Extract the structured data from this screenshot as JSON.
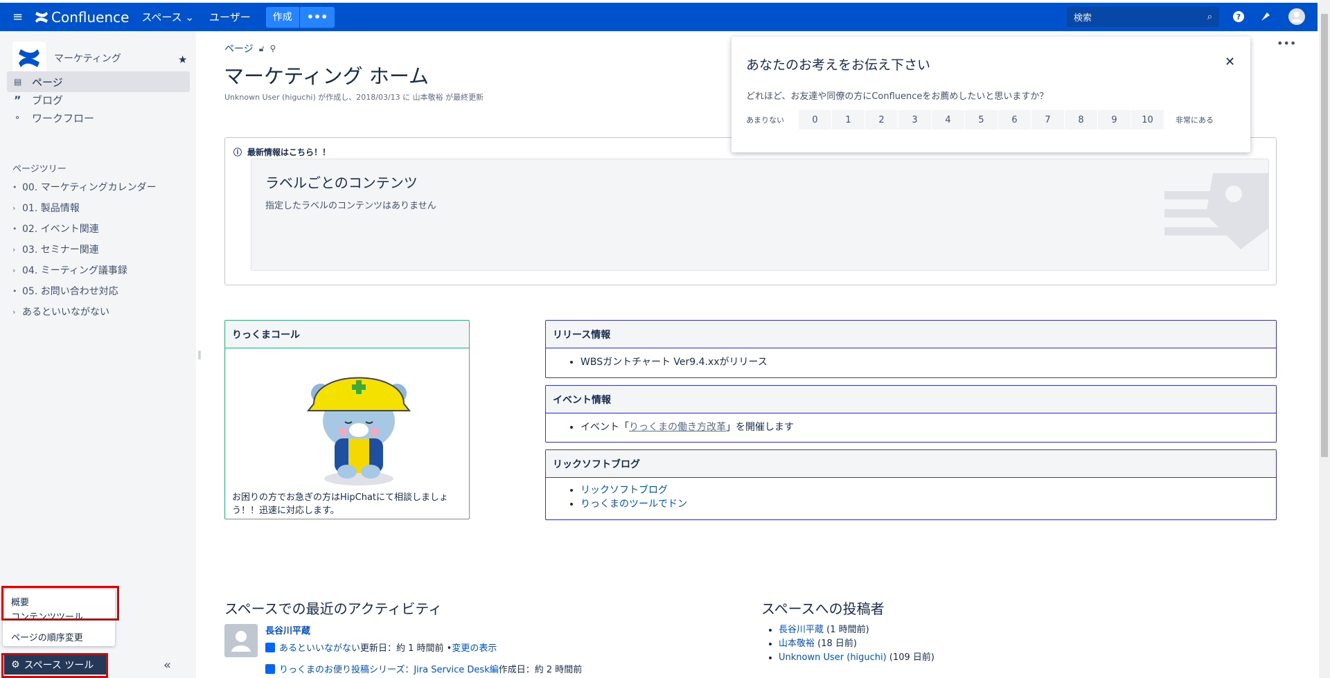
{
  "topbar": {
    "app_name": "Confluence",
    "nav_spaces": "スペース",
    "nav_users": "ユーザー",
    "create_label": "作成",
    "search_placeholder": "検索"
  },
  "sidebar": {
    "space_name": "マーケティング",
    "menu": [
      {
        "label": "ページ",
        "icon": "page-icon",
        "active": true
      },
      {
        "label": "ブログ",
        "icon": "quote-icon",
        "active": false
      },
      {
        "label": "ワークフロー",
        "icon": "workflow-icon",
        "active": false
      }
    ],
    "tree_heading": "ページツリー",
    "tree": [
      {
        "label": "00. マーケティングカレンダー",
        "bullet": "•"
      },
      {
        "label": "01. 製品情報",
        "bullet": "›"
      },
      {
        "label": "02. イベント関連",
        "bullet": "•"
      },
      {
        "label": "03. セミナー関連",
        "bullet": "›"
      },
      {
        "label": "04. ミーティング議事録",
        "bullet": "›"
      },
      {
        "label": "05. お問い合わせ対応",
        "bullet": "•"
      },
      {
        "label": "あるといいながない",
        "bullet": "›"
      }
    ],
    "popup_items": [
      "概要",
      "コンテンツツール",
      "ページの順序変更"
    ],
    "space_tools": "スペース ツール"
  },
  "page": {
    "breadcrumb": "ページ",
    "title": "マーケティング ホーム",
    "meta": "Unknown User (higuchi) が作成し、2018/03/13 に 山本敬裕 が最終更新",
    "info_panel": {
      "heading": "最新情報はこちら！！",
      "inner_title": "ラベルごとのコンテンツ",
      "inner_text": "指定したラベルのコンテンツはありません"
    },
    "rikkuma": {
      "heading": "りっくまコール",
      "text": "お困りの方でお急ぎの方はHipChatにて相談しましょう！！迅速に対応します。"
    },
    "release": {
      "heading": "リリース情報",
      "item": "WBSガントチャート Ver9.4.xxがリリース"
    },
    "event": {
      "heading": "イベント情報",
      "prefix": "イベント「",
      "link": "りっくまの働き方改革",
      "suffix": "」を開催します"
    },
    "blog": {
      "heading": "リックソフトブログ",
      "items": [
        "リックソフトブログ",
        "りっくまのツールでドン"
      ]
    },
    "activity": {
      "heading": "スペースでの最近のアクティビティ",
      "user": "長谷川平蔵",
      "row1_link": "あるといいながない",
      "row1_meta": " 更新日：約 1 時間前 • ",
      "row1_change": "変更の表示",
      "row2_link": "りっくまのお便り投稿シリーズ：Jira Service Desk編",
      "row2_meta": " 作成日：約 2 時間前"
    },
    "contributors": {
      "heading": "スペースへの投稿者",
      "items": [
        {
          "name": "長谷川平蔵",
          "when": " (1 時間前)"
        },
        {
          "name": "山本敬裕",
          "when": " (18 日前)"
        },
        {
          "name": "Unknown User (higuchi)",
          "when": " (109 日前)"
        }
      ]
    }
  },
  "survey": {
    "heading": "あなたのお考えをお伝え下さい",
    "question": "どれほど、お友達や同僚の方にConfluenceをお薦めしたいと思いますか？",
    "low_label": "あまりない",
    "high_label": "非常にある",
    "scale": [
      "0",
      "1",
      "2",
      "3",
      "4",
      "5",
      "6",
      "7",
      "8",
      "9",
      "10"
    ]
  },
  "colors": {
    "brand": "#0052CC",
    "highlight": "#E00000"
  }
}
